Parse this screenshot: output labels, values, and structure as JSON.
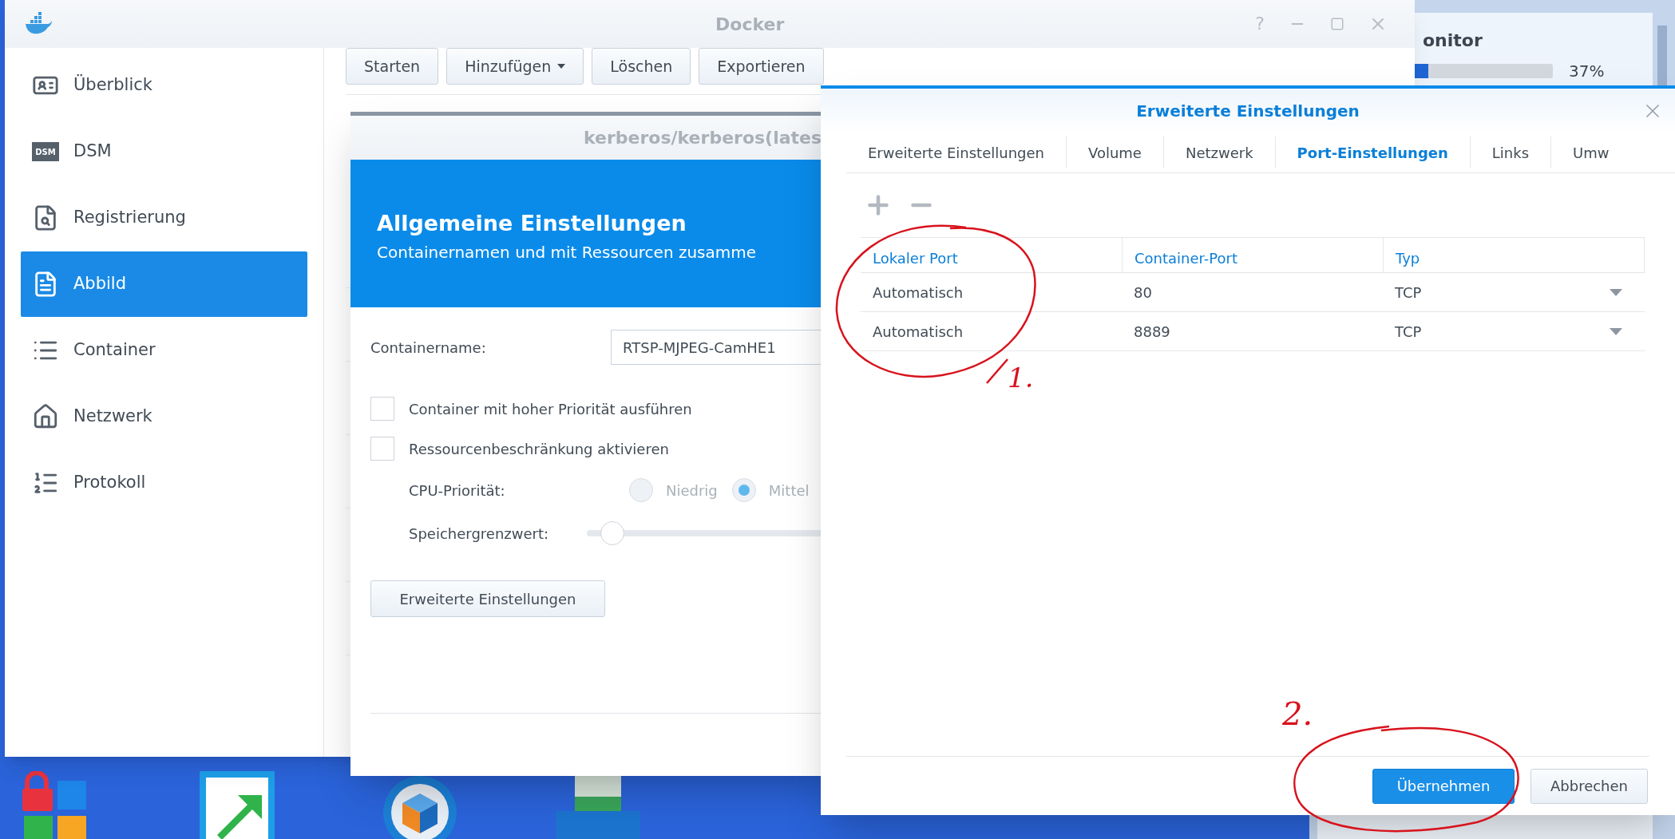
{
  "docker_window": {
    "title": "Docker",
    "help_button": "?",
    "sidebar": [
      {
        "label": "Überblick",
        "selected": false
      },
      {
        "label": "DSM",
        "badge": "DSM",
        "selected": false
      },
      {
        "label": "Registrierung",
        "selected": false
      },
      {
        "label": "Abbild",
        "selected": true
      },
      {
        "label": "Container",
        "selected": false
      },
      {
        "label": "Netzwerk",
        "selected": false
      },
      {
        "label": "Protokoll",
        "selected": false
      }
    ],
    "toolbar": [
      {
        "label": "Starten",
        "dropdown": false
      },
      {
        "label": "Hinzufügen",
        "dropdown": true
      },
      {
        "label": "Löschen",
        "dropdown": false
      },
      {
        "label": "Exportieren",
        "dropdown": false
      }
    ]
  },
  "monitor_widget": {
    "title": "onitor",
    "level": 0.1,
    "reading": "37%"
  },
  "create_dialog": {
    "title": "kerberos/kerberos(lates",
    "heading": "Allgemeine Einstellungen",
    "subheading": "Containernamen und mit Ressourcen zusamme",
    "container_name": {
      "label": "Containername:",
      "value": "RTSP-MJPEG-CamHE1"
    },
    "checkboxes": [
      {
        "label": "Container mit hoher Priorität ausführen",
        "checked": false
      },
      {
        "label": "Ressourcenbeschränkung aktivieren",
        "checked": false
      }
    ],
    "cpu_priority": {
      "label": "CPU-Priorität:",
      "options": [
        {
          "label": "Niedrig",
          "selected": false
        },
        {
          "label": "Mittel",
          "selected": true
        }
      ]
    },
    "memory_limit": {
      "label": "Speichergrenzwert:",
      "level": 0.08
    },
    "advanced_button": "Erweiterte Einstellungen"
  },
  "advanced_dialog": {
    "title": "Erweiterte Einstellungen",
    "tabs": [
      {
        "label": "Erweiterte Einstellungen",
        "selected": false
      },
      {
        "label": "Volume",
        "selected": false
      },
      {
        "label": "Netzwerk",
        "selected": false
      },
      {
        "label": "Port-Einstellungen",
        "selected": true
      },
      {
        "label": "Links",
        "selected": false
      },
      {
        "label": "Umw",
        "selected": false
      }
    ],
    "table": {
      "columns": [
        "Lokaler Port",
        "Container-Port",
        "Typ"
      ],
      "rows": [
        [
          "Automatisch",
          "80",
          "TCP"
        ],
        [
          "Automatisch",
          "8889",
          "TCP"
        ]
      ]
    },
    "buttons": [
      {
        "label": "Übernehmen",
        "kind": "primary"
      },
      {
        "label": "Abbrechen",
        "kind": "secondary"
      }
    ]
  },
  "annotations": [
    {
      "label": "1."
    },
    {
      "label": "2."
    }
  ]
}
